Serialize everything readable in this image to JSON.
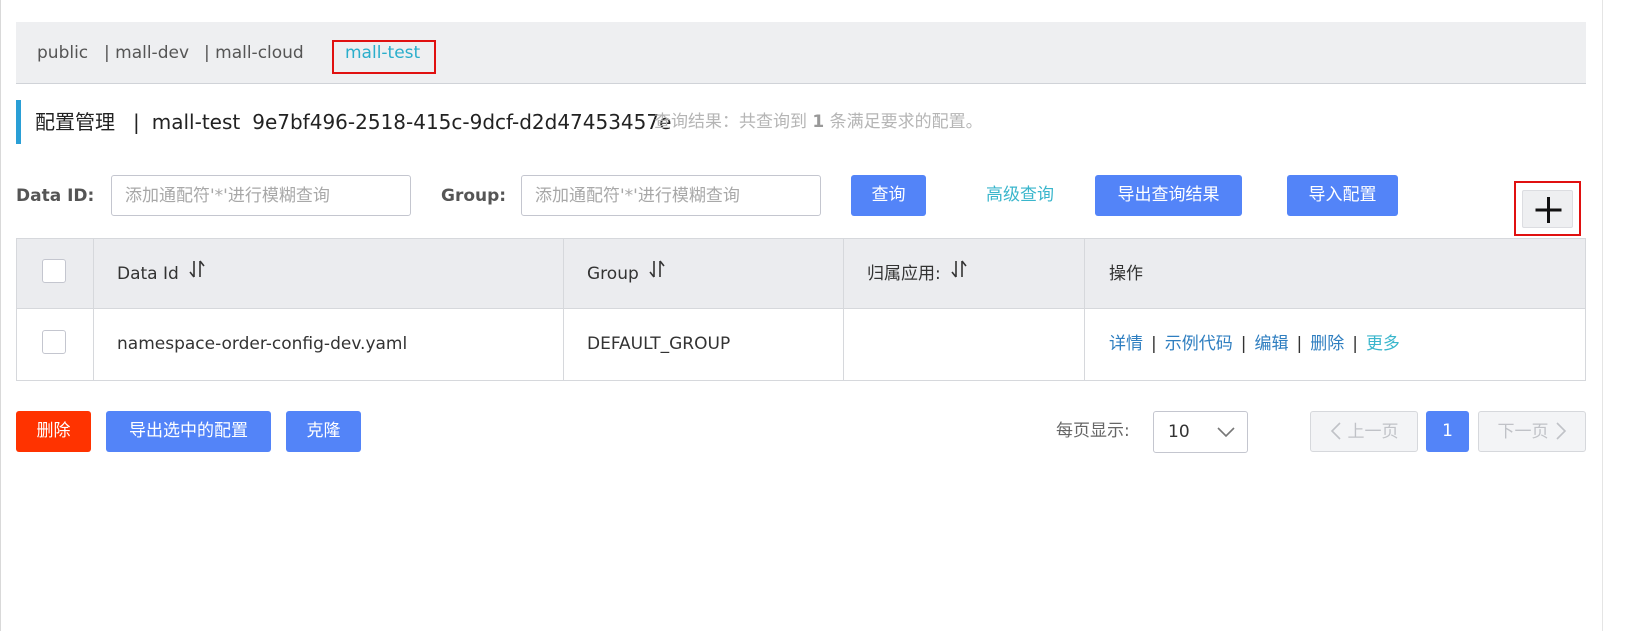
{
  "namespaces": [
    {
      "label": "public"
    },
    {
      "label": "| mall-dev"
    },
    {
      "label": "| mall-cloud"
    },
    {
      "label": "mall-test"
    }
  ],
  "header": {
    "title": "配置管理",
    "separator": "|",
    "namespace_name": "mall-test",
    "namespace_id": "9e7bf496-2518-415c-9dcf-d2d47453457e",
    "result_prefix": "查询结果：共查询到",
    "result_count": "1",
    "result_suffix": "条满足要求的配置。"
  },
  "search": {
    "data_id_label": "Data ID:",
    "data_id_placeholder": "添加通配符'*'进行模糊查询",
    "group_label": "Group:",
    "group_placeholder": "添加通配符'*'进行模糊查询",
    "query_button": "查询",
    "advanced_query": "高级查询",
    "export_results": "导出查询结果",
    "import_config": "导入配置",
    "add_icon": "plus-icon"
  },
  "table": {
    "columns": [
      "Data Id",
      "Group",
      "归属应用:",
      "操作"
    ],
    "rows": [
      {
        "data_id": "namespace-order-config-dev.yaml",
        "group": "DEFAULT_GROUP",
        "app": "",
        "ops": [
          "详情",
          "示例代码",
          "编辑",
          "删除",
          "更多"
        ],
        "op_separator": "|"
      }
    ]
  },
  "footer": {
    "delete_button": "删除",
    "export_selected": "导出选中的配置",
    "clone_button": "克隆",
    "page_size_label": "每页显示:",
    "page_size": "10",
    "prev_page": "上一页",
    "current_page": "1",
    "next_page": "下一页"
  },
  "colors": {
    "primary": "#5384f8",
    "danger": "#ff3300",
    "link": "#2e7ec0",
    "accent": "#3ab6cc",
    "highlight": "#e01010"
  }
}
